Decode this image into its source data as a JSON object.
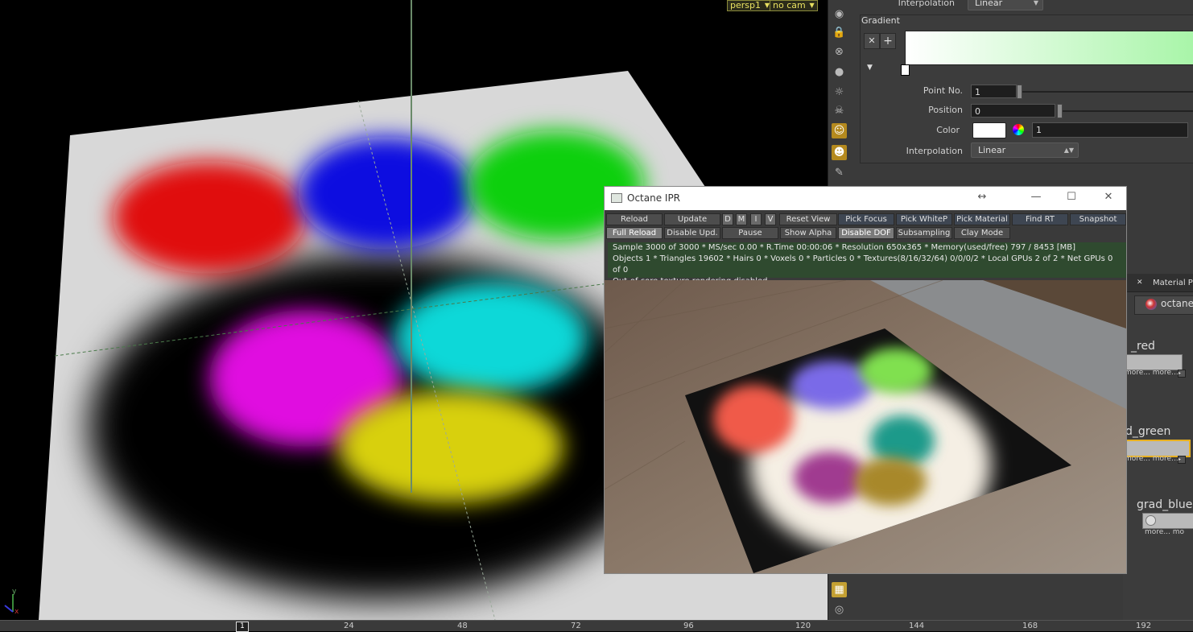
{
  "viewport": {
    "camera_menu": "persp1",
    "cam_menu": "no cam"
  },
  "parameter_panel": {
    "top_interpolation_label": "Interpolation",
    "top_interpolation_value": "Linear",
    "gradient_label": "Gradient",
    "point_no_label": "Point No.",
    "point_no_value": "1",
    "position_label": "Position",
    "position_value": "0",
    "color_label": "Color",
    "color_value": "1",
    "color_swatch": "#ffffff",
    "interpolation_label": "Interpolation",
    "interpolation_value": "Linear",
    "gradient_end_color": "#a8f5a8"
  },
  "network": {
    "tab_label": "Material Pale",
    "path_label": "octane_",
    "nodes": [
      {
        "name": "_red",
        "more1": "more...",
        "more2": "more..."
      },
      {
        "name": "d_green",
        "more1": "more...",
        "more2": "more..."
      },
      {
        "name": "grad_blue",
        "more1": "more...",
        "more2": "mo"
      }
    ]
  },
  "ipr": {
    "title": "Octane IPR",
    "row1": [
      "Reload",
      "Update",
      "D",
      "M",
      "I",
      "V",
      "Reset View",
      "Pick Focus",
      "Pick WhiteP",
      "Pick Material",
      "Find RT",
      "Snapshot"
    ],
    "row2": [
      "Full Reload",
      "Disable Upd.",
      "Pause",
      "Show Alpha",
      "Disable DOF",
      "Subsampling",
      "Clay Mode"
    ],
    "status_line1": "Sample 3000 of 3000 * MS/sec 0.00 * R.Time 00:00:06 * Resolution 650x365 * Memory(used/free) 797 / 8453 [MB]",
    "status_line2": "Objects 1 * Triangles 19602 * Hairs 0 * Voxels 0 * Particles 0 * Textures(8/16/32/64) 0/0/0/2 * Local GPUs 2 of 2 * Net GPUs 0 of 0",
    "status_line3": "Out-of-core texture rendering disabled"
  },
  "timeline": {
    "current_frame": "1",
    "ticks": [
      "24",
      "48",
      "72",
      "96",
      "120",
      "144",
      "168",
      "192"
    ]
  },
  "icons": [
    "eye-icon",
    "lock-icon",
    "close-circle-icon",
    "sphere-icon",
    "light-icon",
    "skull-icon",
    "person-icon",
    "ghost-icon",
    "camera-icon",
    "grid-icon",
    "eye-preview-icon"
  ]
}
